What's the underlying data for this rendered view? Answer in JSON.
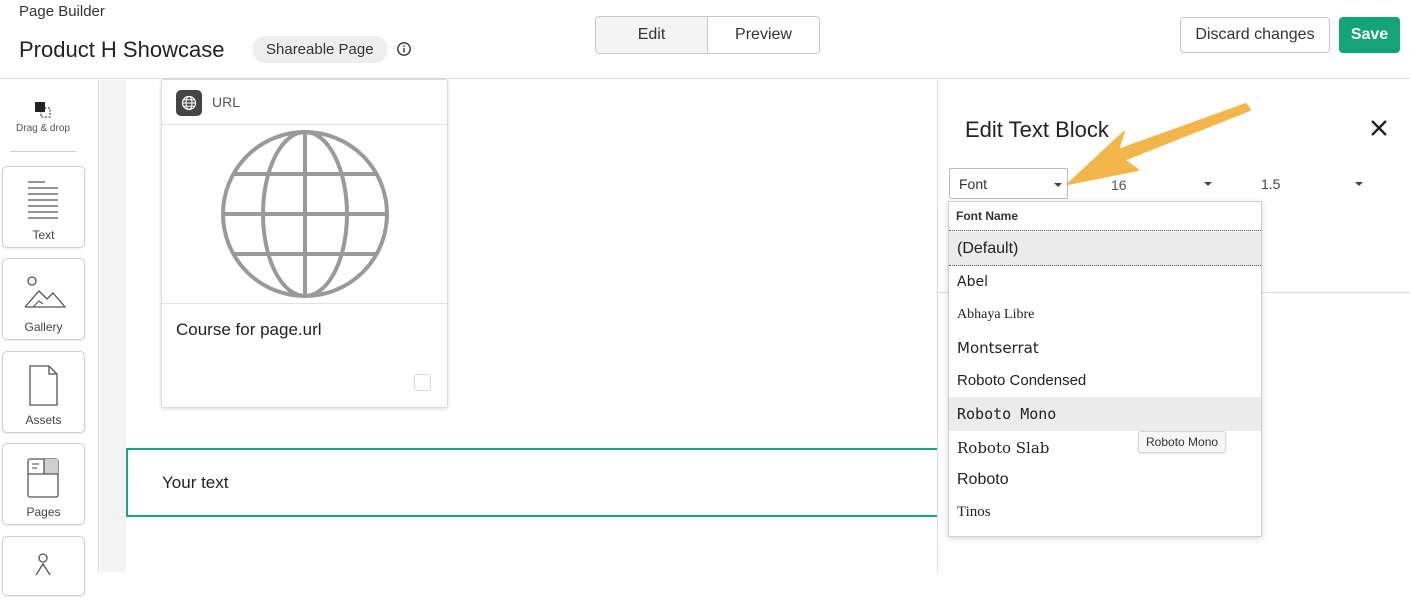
{
  "header": {
    "app_name": "Page Builder",
    "page_title": "Product H Showcase",
    "page_type": "Shareable Page",
    "mode_tabs": [
      {
        "label": "Edit",
        "active": true
      },
      {
        "label": "Preview",
        "active": false
      }
    ],
    "discard_label": "Discard changes",
    "save_label": "Save",
    "save_color": "#13a477"
  },
  "rail": {
    "drag_drop_label": "Drag & drop",
    "tools": [
      {
        "label": "Text",
        "icon": "text-lines-icon"
      },
      {
        "label": "Gallery",
        "icon": "mountain-image-icon"
      },
      {
        "label": "Assets",
        "icon": "document-icon"
      },
      {
        "label": "Pages",
        "icon": "pages-icon"
      },
      {
        "label": "",
        "icon": "person-icon"
      }
    ]
  },
  "canvas": {
    "card": {
      "type_label": "URL",
      "title": "Course for page.url"
    },
    "text_block": {
      "content": "Your text",
      "border_color": "#19a684"
    }
  },
  "panel": {
    "title": "Edit Text Block",
    "font_select": {
      "value": "Font"
    },
    "size_select": {
      "value": "16"
    },
    "line_height_select": {
      "value": "1.5"
    }
  },
  "font_dropdown": {
    "header": "Font Name",
    "options": [
      {
        "label": "(Default)",
        "state": "selected"
      },
      {
        "label": "Abel",
        "state": "normal"
      },
      {
        "label": "Abhaya Libre",
        "state": "normal"
      },
      {
        "label": "Montserrat",
        "state": "normal"
      },
      {
        "label": "Roboto Condensed",
        "state": "normal"
      },
      {
        "label": "Roboto Mono",
        "state": "hover"
      },
      {
        "label": "Roboto Slab",
        "state": "normal"
      },
      {
        "label": "Roboto",
        "state": "normal"
      },
      {
        "label": "Tinos",
        "state": "normal"
      }
    ],
    "tooltip": "Roboto Mono"
  },
  "annotation": {
    "arrow_color": "#f3b64a"
  }
}
